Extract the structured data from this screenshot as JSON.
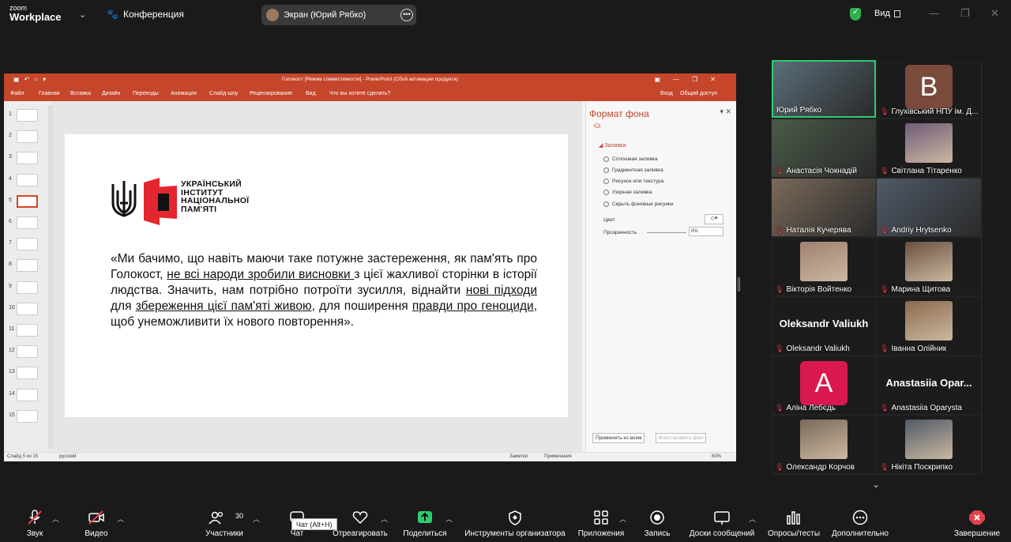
{
  "topbar": {
    "logo_line1": "zoom",
    "logo_line2": "Workplace",
    "meeting_label": "Конференция",
    "share_pill": "Экран (Юрий Рябко)",
    "view_label": "Вид"
  },
  "ppt": {
    "title": "Голокост [Режим совместимости] - PowerPoint (Сбой активации продукта)",
    "tabs": [
      "Файл",
      "Главная",
      "Вставка",
      "Дизайн",
      "Переходы",
      "Анимация",
      "Слайд-шоу",
      "Рецензирование",
      "Вид",
      "Что вы хотите сделать?"
    ],
    "right_login": "Вход",
    "share": "Общий доступ",
    "slide_numbers": [
      "1",
      "2",
      "3",
      "4",
      "5",
      "6",
      "7",
      "8",
      "9",
      "10",
      "11",
      "12",
      "13",
      "14",
      "15"
    ],
    "institute": [
      "УКРАЇНСЬКИЙ",
      "ІНСТИТУТ",
      "НАЦІОНАЛЬНОЇ",
      "ПАМ'ЯТІ"
    ],
    "quote_parts": {
      "p1": "«Ми бачимо, що навіть маючи таке потужне застереження, як пам'ять про Голокост, ",
      "u1": "не всі народи зробили висновки ",
      "p2": "з цієї жахливої сторінки в історії людства. Значить, нам потрібно потроїти зусилля, віднайти ",
      "u2": "нові підходи ",
      "p3": "для ",
      "u3": "збереження цієї пам'яті живою",
      "p4": ", для поширення ",
      "u4": "правди про геноциди",
      "p5": ", щоб унеможливити їх нового повторення»."
    },
    "format_pane": {
      "title": "Формат фона",
      "section": "Заливка",
      "options": [
        "Сплошная заливка",
        "Градиентная заливка",
        "Рисунок или текстура",
        "Узорная заливка"
      ],
      "hide": "Скрыть фоновые рисунки",
      "color": "Цвет",
      "transparency": "Прозрачность",
      "transparency_value": "0%",
      "apply_all": "Применить ко всем",
      "reset": "Восстановить фон"
    },
    "status": {
      "slide": "Слайд 5 из 15",
      "lang": "русский",
      "notes": "Заметки",
      "comments": "Примечания",
      "zoom": "83%"
    }
  },
  "gallery": [
    {
      "name": "Юрий Рябко",
      "muted": false,
      "kind": "video",
      "active": true
    },
    {
      "name": "Глухівський НПУ ім. Д...",
      "muted": true,
      "kind": "letter",
      "letter": "B",
      "color": "#7a4a3c"
    },
    {
      "name": "Анастасія Чокнадій",
      "muted": true,
      "kind": "video"
    },
    {
      "name": "Світлана Тітаренко",
      "muted": true,
      "kind": "photo"
    },
    {
      "name": "Наталія Кучерява",
      "muted": true,
      "kind": "video"
    },
    {
      "name": "Andriy Hrytsenko",
      "muted": true,
      "kind": "video"
    },
    {
      "name": "Вікторія Войтенко",
      "muted": true,
      "kind": "photo"
    },
    {
      "name": "Марина Щитова",
      "muted": true,
      "kind": "photo"
    },
    {
      "name": "Oleksandr Valiukh",
      "muted": true,
      "kind": "name",
      "bigname": "Oleksandr Valiukh"
    },
    {
      "name": "Іванна Олійник",
      "muted": true,
      "kind": "photo"
    },
    {
      "name": "Аліна Лебєдь",
      "muted": true,
      "kind": "letter",
      "letter": "A",
      "color": "#d9184f"
    },
    {
      "name": "Anastasiia Oparysta",
      "muted": true,
      "kind": "name",
      "bigname": "Anastasiia  Opar..."
    },
    {
      "name": "Олександр Корчов",
      "muted": true,
      "kind": "photo"
    },
    {
      "name": "Нікіта Поскрипко",
      "muted": true,
      "kind": "photo"
    }
  ],
  "toolbar": {
    "audio": "Звук",
    "video": "Видео",
    "participants": "Участники",
    "participants_count": "30",
    "chat": "Чат",
    "react": "Отреагировать",
    "share": "Поделиться",
    "host_tools": "Инструменты организатора",
    "apps": "Приложения",
    "record": "Запись",
    "whiteboards": "Доски сообщений",
    "polls": "Опросы/тесты",
    "more": "Дополнительно",
    "end": "Завершение",
    "chat_tooltip": "Чат (Alt+H)"
  }
}
